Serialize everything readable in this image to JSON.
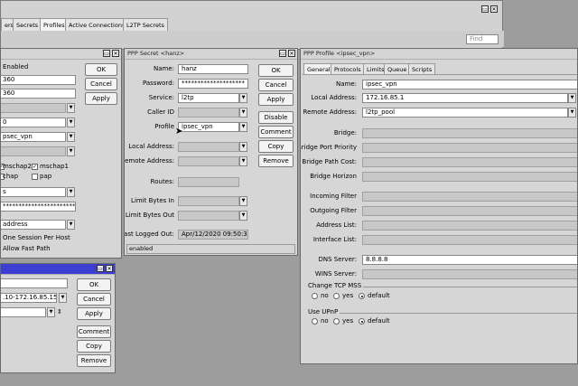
{
  "main_tabs": [
    "ers",
    "Secrets",
    "Profiles",
    "Active Connections",
    "L2TP Secrets"
  ],
  "find_placeholder": "Find",
  "left_window": {
    "buttons": [
      "OK",
      "Cancel",
      "Apply"
    ],
    "fields": [
      "Enabled",
      "360",
      "360",
      "",
      "0",
      "psec_vpn",
      ""
    ],
    "auth": {
      "mschap2": "mschap2",
      "mschap1": "mschap1",
      "chap": "chap",
      "pap": "pap"
    },
    "fields2": [
      "s",
      "********************************",
      "address"
    ],
    "options": [
      "One Session Per Host",
      "Allow Fast Path"
    ]
  },
  "bottom_window": {
    "buttons": [
      "OK",
      "Cancel",
      "Apply",
      "Comment",
      "Copy",
      "Remove"
    ],
    "fields": [
      "",
      ".10-172.16.85.15",
      ""
    ]
  },
  "secret_window": {
    "title": "PPP Secret <hanz>",
    "labels": {
      "name": "Name:",
      "password": "Password:",
      "service": "Service:",
      "caller_id": "Caller ID",
      "profile": "Profile",
      "local_address": "Local Address:",
      "remote_address": "Remote Address:",
      "routes": "Routes:",
      "limit_in": "Limit Bytes In",
      "limit_out": "Limit Bytes Out",
      "last_logged_out": "Last Logged Out:"
    },
    "values": {
      "name": "hanz",
      "password": "********************",
      "service": "l2tp",
      "profile": "ipsec_vpn",
      "last_logged_out": "Apr/12/2020 09:50:30"
    },
    "buttons": [
      "OK",
      "Cancel",
      "Apply",
      "Disable",
      "Comment",
      "Copy",
      "Remove"
    ],
    "status": "enabled"
  },
  "profile_window": {
    "title": "PPP Profile <ipsec_vpn>",
    "tabs": [
      "General",
      "Protocols",
      "Limits",
      "Queue",
      "Scripts"
    ],
    "labels": {
      "name": "Name:",
      "local_address": "Local Address:",
      "remote_address": "Remote Address:",
      "bridge": "Bridge:",
      "bridge_port_priority": "Bridge Port Priority",
      "bridge_path_cost": "Bridge Path Cost:",
      "bridge_horizon": "Bridge Horizon",
      "incoming_filter": "Incoming Filter",
      "outgoing_filter": "Outgoing Filter",
      "address_list": "Address List:",
      "interface_list": "Interface List:",
      "dns_server": "DNS Server:",
      "wins_server": "WINS Server:"
    },
    "values": {
      "name": "ipsec_vpn",
      "local_address": "172.16.85.1",
      "remote_address": "l2tp_pool",
      "dns_server": "8.8.8.8"
    },
    "tcp_mss": {
      "label": "Change TCP MSS",
      "no": "no",
      "yes": "yes",
      "default": "default"
    },
    "upnp": {
      "label": "Use UPnP",
      "no": "no",
      "yes": "yes",
      "default": "default"
    }
  }
}
